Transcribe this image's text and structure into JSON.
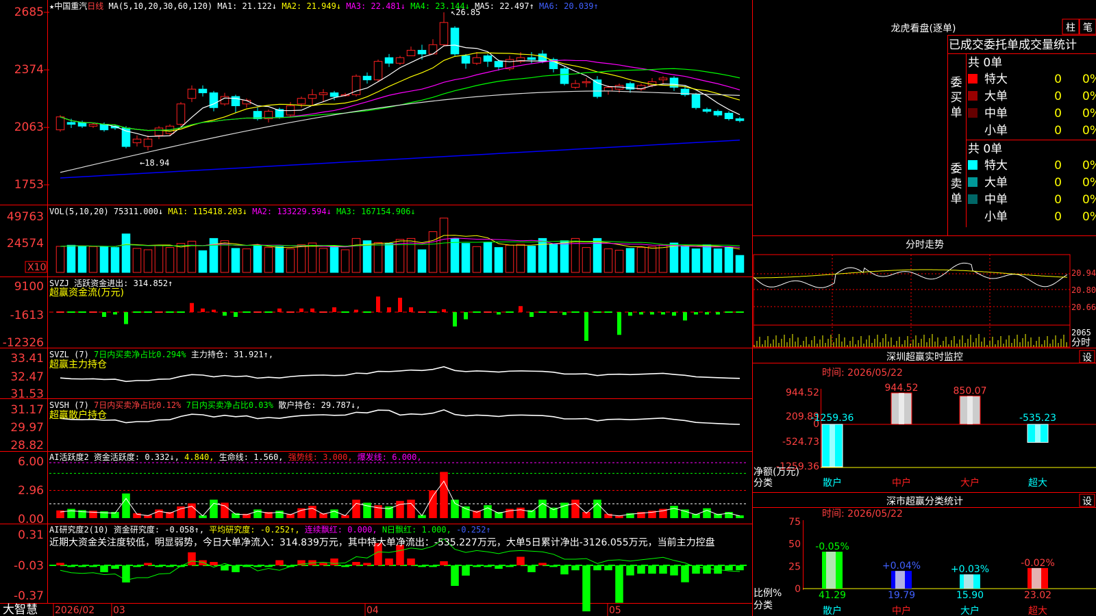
{
  "stock_title": "★中国重汽",
  "period": "日线",
  "ma_header": {
    "name": "MA(5,10,20,30,60,120)",
    "items": [
      {
        "label": "MA1:",
        "value": "21.122",
        "arrow": "↓",
        "color": "#ffffff"
      },
      {
        "label": "MA2:",
        "value": "21.949",
        "arrow": "↓",
        "color": "#ffff00"
      },
      {
        "label": "MA3:",
        "value": "22.481",
        "arrow": "↓",
        "color": "#ff00ff"
      },
      {
        "label": "MA4:",
        "value": "23.144",
        "arrow": "↓",
        "color": "#00ff00"
      },
      {
        "label": "MA5:",
        "value": "22.497",
        "arrow": "↑",
        "color": "#ffffff"
      },
      {
        "label": "MA6:",
        "value": "20.039",
        "arrow": "↑",
        "color": "#0000ff"
      }
    ]
  },
  "price_axis": [
    "2685",
    "2374",
    "2063",
    "1753"
  ],
  "high_mark": "26.85",
  "low_mark": "18.94",
  "vol_header": {
    "name": "VOL(5,10,20)",
    "value": "75311.000",
    "arrow": "↓",
    "items": [
      {
        "label": "MA1:",
        "value": "115418.203",
        "arrow": "↓",
        "color": "#ffff00"
      },
      {
        "label": "MA2:",
        "value": "133229.594",
        "arrow": "↓",
        "color": "#ff00ff"
      },
      {
        "label": "MA3:",
        "value": "167154.906",
        "arrow": "↓",
        "color": "#00ff00"
      }
    ]
  },
  "vol_axis": [
    "49763",
    "24574"
  ],
  "vol_unit": "X10",
  "svzj_header": {
    "name": "SVZJ",
    "text": "活跃资金进出:",
    "value": "314.852",
    "arrow": "↑",
    "subtitle": "超赢资金流(万元)"
  },
  "svzj_axis": [
    "9100",
    "-1613",
    "-12326"
  ],
  "svzl_header": {
    "name": "SVZL (7)",
    "a": "7日内买卖净占比0.294%",
    "b": "主力持仓:",
    "value": "31.921",
    "arrow": "↑",
    "subtitle": "超赢主力持仓"
  },
  "svzl_axis": [
    "33.41",
    "32.47",
    "31.53"
  ],
  "svsh_header": {
    "name": "SVSH (7)",
    "a": "7日内买卖净占比0.12%",
    "b": "7日内买卖净占比0.03%",
    "c": "散户持仓:",
    "value": "29.787",
    "arrow": "↓",
    "subtitle": "超赢散户持仓"
  },
  "svsh_axis": [
    "31.17",
    "29.97",
    "28.82"
  ],
  "ai1_header": {
    "name": "AI活跃度2",
    "a": "资金活跃度:",
    "a_val": "0.332",
    "a_arrow": "↓",
    "b_val": "4.840",
    "c": "生命线:",
    "c_val": "1.560",
    "d": "强势线:",
    "d_val": "3.000",
    "e": "爆发线:",
    "e_val": "6.000"
  },
  "ai1_axis": [
    "6.00",
    "2.96",
    "0.00"
  ],
  "ai2_header": {
    "name": "AI研究度2(10)",
    "a": "资金研究度:",
    "a_val": "-0.058",
    "a_arrow": "↑",
    "b": "平均研究度:",
    "b_val": "-0.252",
    "b_arrow": "↑",
    "c": "连续飘红:",
    "c_val": "0.000",
    "d": "N日飘红:",
    "d_val": "1.000",
    "e_val": "-0.252",
    "e_arrow": "↑"
  },
  "ai2_note": "近期大资金关注度较低，明显弱势，今日大单净流入：314.839万元，其中特大单净流出：-535.227万元，大单5日累计净出-3126.055万元，当前主力控盘",
  "ai2_axis": [
    "0.31",
    "-0.03",
    "-0.37"
  ],
  "date_axis": [
    "2026/02",
    "03",
    "04",
    "05"
  ],
  "brand": "大智慧",
  "right": {
    "lhb_title": "龙虎看盘(逐单)",
    "btn_bar": "柱",
    "btn_stroke": "笔",
    "stats_title": "已成交委托单成交量统计",
    "buy": {
      "label": "委买单",
      "total": "共 0单",
      "rows": [
        {
          "name": "特大",
          "qty": "0",
          "pct": "0%",
          "color": "#ff0000"
        },
        {
          "name": "大单",
          "qty": "0",
          "pct": "0%",
          "color": "#990000"
        },
        {
          "name": "中单",
          "qty": "0",
          "pct": "0%",
          "color": "#660000"
        },
        {
          "name": "小单",
          "qty": "0",
          "pct": "0%",
          "color": ""
        }
      ]
    },
    "sell": {
      "label": "委卖单",
      "total": "共 0单",
      "rows": [
        {
          "name": "特大",
          "qty": "0",
          "pct": "0%",
          "color": "#00ffff"
        },
        {
          "name": "大单",
          "qty": "0",
          "pct": "0%",
          "color": "#009999"
        },
        {
          "name": "中单",
          "qty": "0",
          "pct": "0%",
          "color": "#006666"
        },
        {
          "name": "小单",
          "qty": "0",
          "pct": "0%",
          "color": ""
        }
      ]
    },
    "fs_title": "分时走势",
    "fs_axis": [
      "20.94",
      "20.80",
      "20.66"
    ],
    "fs_vol_axis": [
      "2065",
      "分时"
    ],
    "sz_title": "深圳超赢实时监控",
    "sz_btn": "设",
    "sz_time": "时间: 2026/05/22",
    "sz_axis": [
      "944.52",
      "209.89",
      "0",
      "-524.73",
      "-1259.36"
    ],
    "sz_ylabel": "净额(万元)",
    "sz_xlabel": "分类",
    "sz_cats": [
      "散户",
      "中户",
      "大户",
      "超大"
    ],
    "sz_values": [
      "-1259.36",
      "944.52",
      "850.07",
      "-535.23"
    ],
    "cls_title": "深市超赢分类统计",
    "cls_btn": "设",
    "cls_time": "时间: 2026/05/22",
    "cls_axis": [
      "75",
      "50",
      "25",
      "0"
    ],
    "cls_ylabel": "比例%",
    "cls_xlabel": "分类",
    "cls_cats": [
      "散户",
      "中户",
      "大户",
      "超大"
    ],
    "cls_values": [
      "41.29",
      "19.79",
      "15.90",
      "23.02"
    ],
    "cls_changes": [
      "-0.05%",
      "+0.04%",
      "+0.03%",
      "-0.02%"
    ]
  },
  "chart_data": {
    "type": "candlestick",
    "ylim": [
      17.53,
      26.85
    ],
    "candles": [
      [
        20.5,
        21.2,
        20.4,
        21.3
      ],
      [
        20.9,
        20.8,
        20.6,
        21.1
      ],
      [
        20.9,
        20.7,
        20.6,
        21.0
      ],
      [
        20.7,
        20.8,
        20.6,
        20.9
      ],
      [
        20.8,
        20.5,
        20.4,
        20.9
      ],
      [
        20.7,
        20.6,
        20.5,
        20.8
      ],
      [
        20.6,
        19.6,
        19.5,
        20.7
      ],
      [
        19.8,
        20.0,
        19.6,
        20.2
      ],
      [
        19.6,
        20.0,
        19.4,
        20.2
      ],
      [
        20.2,
        20.6,
        20.0,
        20.7
      ],
      [
        20.3,
        20.7,
        20.2,
        20.8
      ],
      [
        20.8,
        21.9,
        20.7,
        22.0
      ],
      [
        22.2,
        22.7,
        22.0,
        22.9
      ],
      [
        22.7,
        22.5,
        22.3,
        22.9
      ],
      [
        22.5,
        21.7,
        21.5,
        22.6
      ],
      [
        21.9,
        22.3,
        21.8,
        22.5
      ],
      [
        22.3,
        21.8,
        21.4,
        22.4
      ],
      [
        21.9,
        22.1,
        21.7,
        22.2
      ],
      [
        21.5,
        21.1,
        21.0,
        21.7
      ],
      [
        21.1,
        21.5,
        20.9,
        21.6
      ],
      [
        21.6,
        21.2,
        21.1,
        21.7
      ],
      [
        21.3,
        21.8,
        21.2,
        22.0
      ],
      [
        21.9,
        22.2,
        21.7,
        22.3
      ],
      [
        22.2,
        22.4,
        21.8,
        22.7
      ],
      [
        22.4,
        22.5,
        22.0,
        22.7
      ],
      [
        22.5,
        22.3,
        22.1,
        22.6
      ],
      [
        22.4,
        22.4,
        22.3,
        22.5
      ],
      [
        22.4,
        23.4,
        22.3,
        23.5
      ],
      [
        23.4,
        23.2,
        23.0,
        23.6
      ],
      [
        23.2,
        24.2,
        23.1,
        24.3
      ],
      [
        24.4,
        24.1,
        23.9,
        24.6
      ],
      [
        24.1,
        24.4,
        24.0,
        24.5
      ],
      [
        24.5,
        24.8,
        24.5,
        25.0
      ],
      [
        24.8,
        24.6,
        24.3,
        25.1
      ],
      [
        24.6,
        25.1,
        24.6,
        25.4
      ],
      [
        25.1,
        26.3,
        25.0,
        26.85
      ],
      [
        26.0,
        24.6,
        24.5,
        26.1
      ],
      [
        24.5,
        24.1,
        23.8,
        24.6
      ],
      [
        24.1,
        24.4,
        24.0,
        24.7
      ],
      [
        24.5,
        24.2,
        23.9,
        24.6
      ],
      [
        24.2,
        23.9,
        23.7,
        24.3
      ],
      [
        23.8,
        24.3,
        23.7,
        24.5
      ],
      [
        24.2,
        24.4,
        24.1,
        24.7
      ],
      [
        24.4,
        24.3,
        24.1,
        24.7
      ],
      [
        24.6,
        24.2,
        24.1,
        24.8
      ],
      [
        24.3,
        23.8,
        23.6,
        24.4
      ],
      [
        23.8,
        23.0,
        22.9,
        23.9
      ],
      [
        22.8,
        23.0,
        22.7,
        23.2
      ],
      [
        23.1,
        23.1,
        22.8,
        23.3
      ],
      [
        23.2,
        22.3,
        22.2,
        23.4
      ],
      [
        22.6,
        22.8,
        22.4,
        22.9
      ],
      [
        22.7,
        22.9,
        22.5,
        23.0
      ],
      [
        23.0,
        22.7,
        22.5,
        23.1
      ],
      [
        22.7,
        22.9,
        22.6,
        23.0
      ],
      [
        22.9,
        23.1,
        22.8,
        23.3
      ],
      [
        23.2,
        23.3,
        23.0,
        23.4
      ],
      [
        23.3,
        22.8,
        22.6,
        23.4
      ],
      [
        22.7,
        22.4,
        22.3,
        22.9
      ],
      [
        22.4,
        21.7,
        21.6,
        22.5
      ],
      [
        21.6,
        21.5,
        21.4,
        21.7
      ],
      [
        21.5,
        21.3,
        21.2,
        21.6
      ],
      [
        21.4,
        21.1,
        21.0,
        21.5
      ],
      [
        21.1,
        21.0,
        20.9,
        21.2
      ]
    ],
    "volume": [
      115,
      120,
      116,
      114,
      112,
      110,
      170,
      106,
      100,
      118,
      110,
      128,
      138,
      96,
      150,
      140,
      106,
      104,
      118,
      110,
      114,
      104,
      122,
      130,
      106,
      118,
      100,
      150,
      140,
      132,
      128,
      146,
      150,
      100,
      180,
      240,
      150,
      128,
      114,
      132,
      110,
      120,
      124,
      116,
      150,
      124,
      140,
      150,
      110,
      150,
      104,
      98,
      106,
      110,
      114,
      120,
      130,
      118,
      104,
      122,
      104,
      110,
      75
    ],
    "fund_flow": [
      0,
      0,
      0,
      0,
      -2000,
      -1000,
      -5000,
      0,
      0,
      0,
      0,
      0,
      3800,
      1500,
      1000,
      -1500,
      -2000,
      0,
      0,
      0,
      1500,
      0,
      1500,
      1500,
      0,
      2000,
      0,
      1000,
      0,
      6500,
      2000,
      6000,
      2000,
      0,
      0,
      1200,
      -6000,
      -3000,
      0,
      0,
      -1000,
      0,
      2500,
      -2000,
      0,
      0,
      -1200,
      0,
      -12000,
      0,
      0,
      -9500,
      -1500,
      -1000,
      -1000,
      -1000,
      -1500,
      -3500,
      -1000,
      -1000,
      -1000,
      0,
      0
    ]
  }
}
